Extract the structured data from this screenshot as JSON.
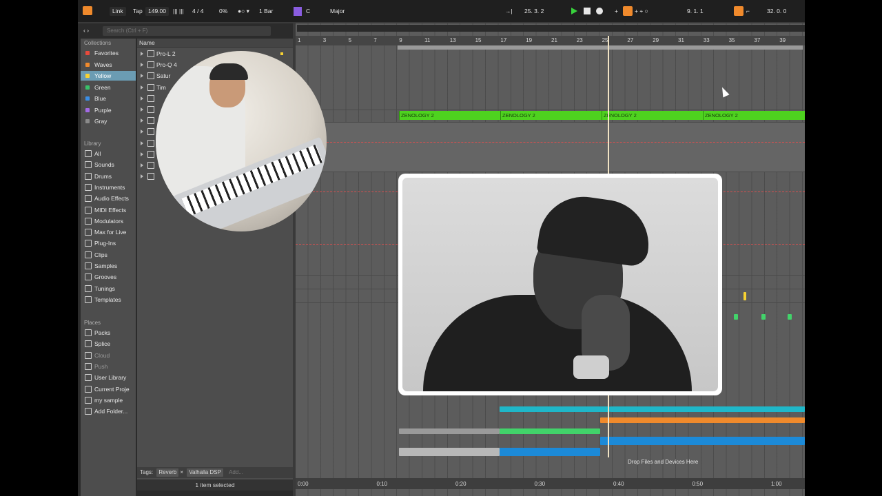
{
  "topbar": {
    "link": "Link",
    "tap": "Tap",
    "tempo": "149.00",
    "signature": "4 / 4",
    "groove": "0%",
    "quantize": "1 Bar",
    "key": "C",
    "scale": "Major",
    "arrangement_position": "25.   3.   2",
    "loop_start": "9.   1.   1",
    "loop_length": "32.   0.   0"
  },
  "browser": {
    "search_placeholder": "Search (Ctrl + F)",
    "collections_header": "Collections",
    "collections": [
      {
        "label": "Favorites",
        "color": "#e84a3c"
      },
      {
        "label": "Waves",
        "color": "#f08a2c"
      },
      {
        "label": "Yellow",
        "color": "#f7d232"
      },
      {
        "label": "Green",
        "color": "#39c26a"
      },
      {
        "label": "Blue",
        "color": "#3a8ee6"
      },
      {
        "label": "Purple",
        "color": "#a36ae6"
      },
      {
        "label": "Gray",
        "color": "#8a8a8a"
      }
    ],
    "library_header": "Library",
    "library": [
      "All",
      "Sounds",
      "Drums",
      "Instruments",
      "Audio Effects",
      "MIDI Effects",
      "Modulators",
      "Max for Live",
      "Plug-Ins",
      "Clips",
      "Samples",
      "Grooves",
      "Tunings",
      "Templates"
    ],
    "places_header": "Places",
    "places": [
      "Packs",
      "Splice",
      "Cloud",
      "Push",
      "User Library",
      "Current Proje",
      "my sample",
      "Add Folder..."
    ],
    "list_header": "Name",
    "list_items": [
      "Pro-L 2",
      "Pro-Q 4",
      "Satur",
      "Tim"
    ],
    "tags_label": "Tags:",
    "tags": [
      "Reverb",
      "Valhalla DSP"
    ],
    "tags_add": "Add...",
    "status": "1 item selected"
  },
  "arrangement": {
    "bar_numbers": [
      "1",
      "3",
      "5",
      "7",
      "9",
      "11",
      "13",
      "15",
      "17",
      "19",
      "21",
      "23",
      "25",
      "27",
      "29",
      "31",
      "33",
      "35",
      "37",
      "39"
    ],
    "clip_label": "ZENOLOGY 2",
    "drop_hint": "Drop Files and Devices Here",
    "time_labels": [
      "0:00",
      "0:10",
      "0:20",
      "0:30",
      "0:40",
      "0:50",
      "1:00"
    ]
  }
}
